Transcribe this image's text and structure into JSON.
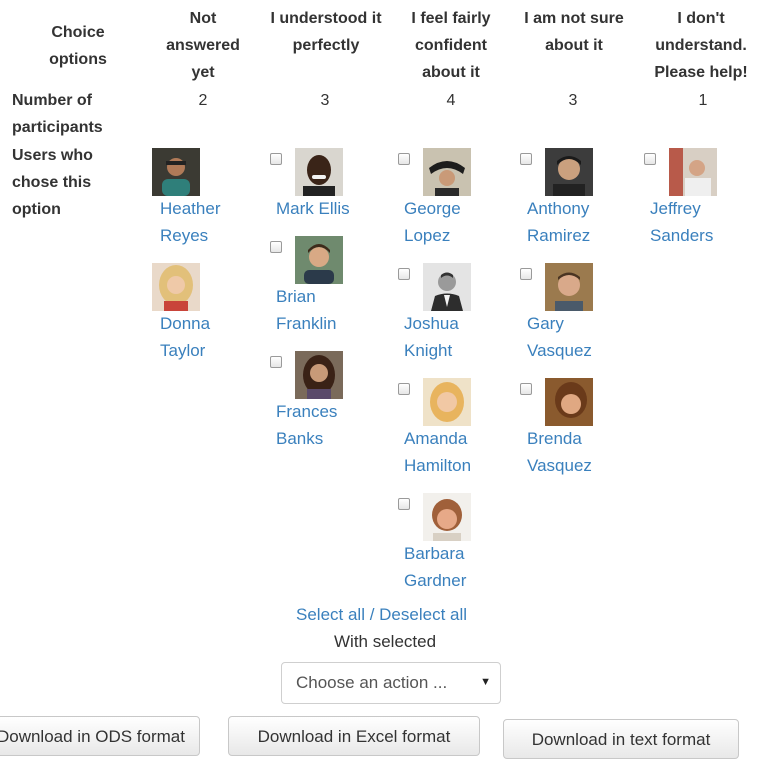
{
  "header_row": {
    "choice_options": [
      "Choice",
      "options"
    ],
    "columns": [
      [
        "Not",
        "answered",
        "yet"
      ],
      [
        "I understood it",
        "perfectly"
      ],
      [
        "I feel fairly",
        "confident",
        "about it"
      ],
      [
        "I am not sure",
        "about it"
      ],
      [
        "I don't",
        "understand.",
        "Please help!"
      ]
    ]
  },
  "participants_row": {
    "label": [
      "Number of",
      "participants"
    ],
    "counts": [
      "2",
      "3",
      "4",
      "3",
      "1"
    ]
  },
  "users_row": {
    "label": [
      "Users who",
      "chose this",
      "option"
    ]
  },
  "users": {
    "not_answered": [
      {
        "first": "Heather",
        "last": "Reyes"
      },
      {
        "first": "Donna",
        "last": "Taylor"
      }
    ],
    "understood": [
      {
        "first": "Mark Ellis",
        "last": ""
      },
      {
        "first": "Brian",
        "last": "Franklin"
      },
      {
        "first": "Frances",
        "last": "Banks"
      }
    ],
    "fairly_confident": [
      {
        "first": "George",
        "last": "Lopez"
      },
      {
        "first": "Joshua",
        "last": "Knight"
      },
      {
        "first": "Amanda",
        "last": "Hamilton"
      },
      {
        "first": "Barbara",
        "last": "Gardner"
      }
    ],
    "not_sure": [
      {
        "first": "Anthony",
        "last": "Ramirez"
      },
      {
        "first": "Gary",
        "last": "Vasquez"
      },
      {
        "first": "Brenda",
        "last": "Vasquez"
      }
    ],
    "dont_understand": [
      {
        "first": "Jeffrey",
        "last": "Sanders"
      }
    ]
  },
  "select_all_label": "Select all",
  "separator": " / ",
  "deselect_all_label": "Deselect all",
  "with_selected_label": "With selected",
  "action_select": {
    "value": "Choose an action ...",
    "arrow": "▼"
  },
  "buttons": {
    "ods": "Download in ODS format",
    "excel": "Download in Excel format",
    "text": "Download in text format"
  },
  "colors": {
    "link": "#3a80bd",
    "text": "#333333"
  }
}
